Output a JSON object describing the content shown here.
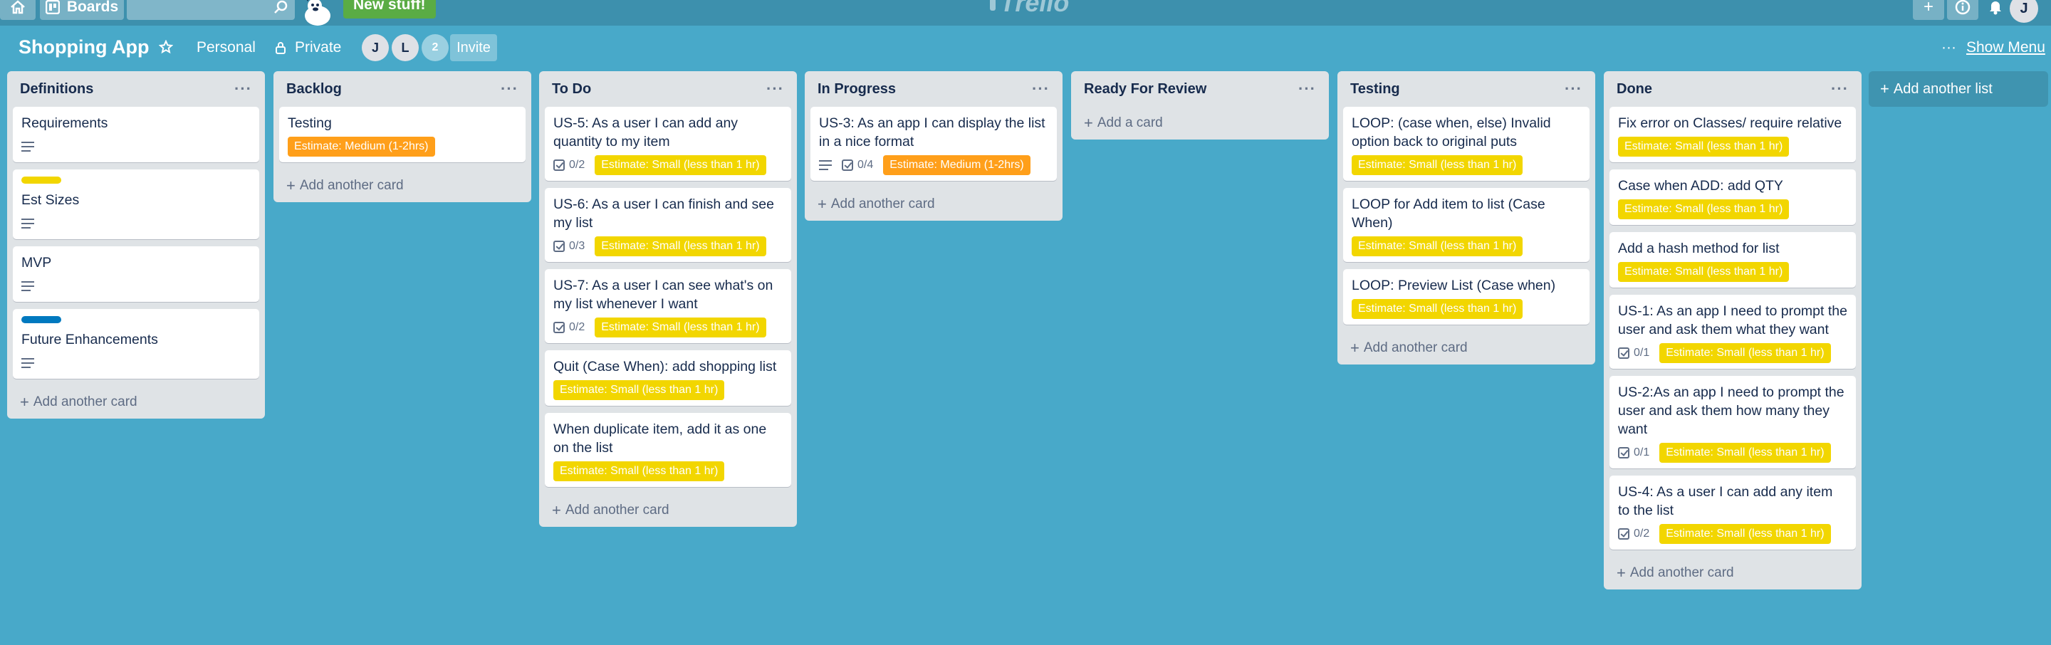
{
  "header": {
    "home_icon": "home-icon",
    "boards_label": "Boards",
    "search": {
      "value": "",
      "placeholder": ""
    },
    "new_stuff_label": "New stuff!",
    "logo_text": "Trello",
    "avatar_initial": "J"
  },
  "board": {
    "title": "Shopping App",
    "personal_label": "Personal",
    "visibility_label": "Private",
    "members": [
      "J",
      "L"
    ],
    "member_count": "2",
    "invite_label": "Invite",
    "show_menu_label": "Show Menu",
    "add_list_label": "Add another list"
  },
  "colors": {
    "board_bg": "#48a9c9",
    "label_small": "#f2d600",
    "label_medium": "#ff9f1a",
    "label_bar_yellow": "#f2d600",
    "label_bar_blue": "#0079bf",
    "new_stuff": "#5aac44"
  },
  "lists": [
    {
      "title": "Definitions",
      "add_label": "Add another card",
      "cards": [
        {
          "title": "Requirements",
          "description": true
        },
        {
          "title": "Est Sizes",
          "label_bar": "#f2d600",
          "description": true
        },
        {
          "title": "MVP",
          "description": true
        },
        {
          "title": "Future Enhancements",
          "label_bar": "#0079bf",
          "description": true
        }
      ]
    },
    {
      "title": "Backlog",
      "add_label": "Add another card",
      "cards": [
        {
          "title": "Testing",
          "labels": [
            {
              "text": "Estimate: Medium (1-2hrs)",
              "kind": "medium"
            }
          ]
        }
      ]
    },
    {
      "title": "To Do",
      "add_label": "Add another card",
      "cards": [
        {
          "title": "US-5: As a user I can add any quantity to my item",
          "checklist": "0/2",
          "labels": [
            {
              "text": "Estimate: Small (less than 1 hr)",
              "kind": "small"
            }
          ]
        },
        {
          "title": "US-6: As a user I can finish and see my list",
          "checklist": "0/3",
          "labels": [
            {
              "text": "Estimate: Small (less than 1 hr)",
              "kind": "small"
            }
          ]
        },
        {
          "title": "US-7: As a user I can see what's on my list whenever I want",
          "checklist": "0/2",
          "labels": [
            {
              "text": "Estimate: Small (less than 1 hr)",
              "kind": "small"
            }
          ]
        },
        {
          "title": "Quit (Case When): add shopping list",
          "labels": [
            {
              "text": "Estimate: Small (less than 1 hr)",
              "kind": "small"
            }
          ]
        },
        {
          "title": "When duplicate item, add it as one on the list",
          "labels": [
            {
              "text": "Estimate: Small (less than 1 hr)",
              "kind": "small"
            }
          ]
        }
      ]
    },
    {
      "title": "In Progress",
      "add_label": "Add another card",
      "cards": [
        {
          "title": "US-3: As an app I can display the list in a nice format",
          "description": true,
          "checklist": "0/4",
          "labels": [
            {
              "text": "Estimate: Medium (1-2hrs)",
              "kind": "medium"
            }
          ]
        }
      ]
    },
    {
      "title": "Ready For Review",
      "add_label": "Add a card",
      "cards": []
    },
    {
      "title": "Testing",
      "add_label": "Add another card",
      "cards": [
        {
          "title": "LOOP: (case when, else) Invalid option back to original puts",
          "labels": [
            {
              "text": "Estimate: Small (less than 1 hr)",
              "kind": "small"
            }
          ]
        },
        {
          "title": "LOOP for Add item to list (Case When)",
          "labels": [
            {
              "text": "Estimate: Small (less than 1 hr)",
              "kind": "small"
            }
          ]
        },
        {
          "title": "LOOP: Preview List (Case when)",
          "labels": [
            {
              "text": "Estimate: Small (less than 1 hr)",
              "kind": "small"
            }
          ]
        }
      ]
    },
    {
      "title": "Done",
      "add_label": "Add another card",
      "cards": [
        {
          "title": "Fix error on Classes/ require relative",
          "labels": [
            {
              "text": "Estimate: Small (less than 1 hr)",
              "kind": "small"
            }
          ]
        },
        {
          "title": "Case when ADD: add QTY",
          "labels": [
            {
              "text": "Estimate: Small (less than 1 hr)",
              "kind": "small"
            }
          ]
        },
        {
          "title": "Add a hash method for list",
          "labels": [
            {
              "text": "Estimate: Small (less than 1 hr)",
              "kind": "small"
            }
          ]
        },
        {
          "title": "US-1: As an app I need to prompt the user and ask them what they want",
          "checklist": "0/1",
          "labels": [
            {
              "text": "Estimate: Small (less than 1 hr)",
              "kind": "small"
            }
          ]
        },
        {
          "title": "US-2:As an app I need to prompt the user and ask them how many they want",
          "checklist": "0/1",
          "labels": [
            {
              "text": "Estimate: Small (less than 1 hr)",
              "kind": "small"
            }
          ]
        },
        {
          "title": "US-4: As a user I can add any item to the list",
          "checklist": "0/2",
          "labels": [
            {
              "text": "Estimate: Small (less than 1 hr)",
              "kind": "small"
            }
          ]
        }
      ]
    }
  ]
}
